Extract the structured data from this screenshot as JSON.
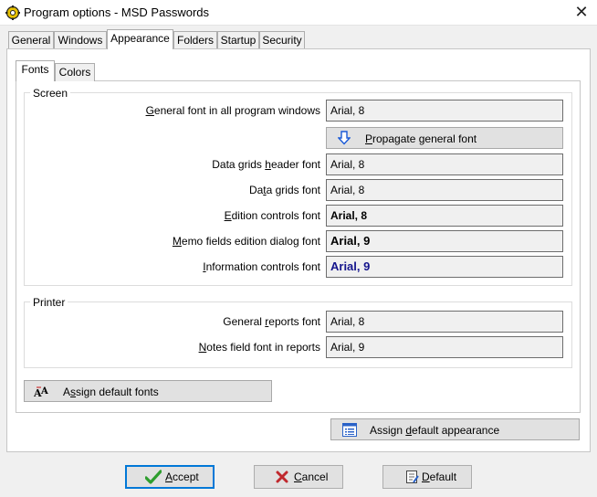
{
  "window": {
    "title": "Program options - MSD Passwords"
  },
  "tabs": [
    {
      "label": "General"
    },
    {
      "label": "Windows"
    },
    {
      "label": "Appearance"
    },
    {
      "label": "Folders"
    },
    {
      "label": "Startup"
    },
    {
      "label": "Security"
    }
  ],
  "subtabs": [
    {
      "label": "Fonts"
    },
    {
      "label": "Colors"
    }
  ],
  "screen": {
    "legend": "Screen",
    "rows": [
      {
        "label_pre": "",
        "label_key": "G",
        "label_post": "eneral font in all program windows",
        "value": "Arial, 8"
      },
      {
        "label_pre": "Data grids ",
        "label_key": "h",
        "label_post": "eader font",
        "value": "Arial, 8"
      },
      {
        "label_pre": "Da",
        "label_key": "t",
        "label_post": "a grids font",
        "value": "Arial, 8"
      },
      {
        "label_pre": "",
        "label_key": "E",
        "label_post": "dition controls font",
        "value": "Arial, 8"
      },
      {
        "label_pre": "",
        "label_key": "M",
        "label_post": "emo fields edition dialog font",
        "value": "Arial, 9"
      },
      {
        "label_pre": "",
        "label_key": "I",
        "label_post": "nformation controls font",
        "value": "Arial, 9"
      }
    ],
    "propagate": {
      "pre": "",
      "key": "P",
      "post": "ropagate general font"
    }
  },
  "printer": {
    "legend": "Printer",
    "rows": [
      {
        "label_pre": "General ",
        "label_key": "r",
        "label_post": "eports font",
        "value": "Arial, 8"
      },
      {
        "label_pre": "",
        "label_key": "N",
        "label_post": "otes field font in reports",
        "value": "Arial, 9"
      }
    ]
  },
  "assign_default_fonts": {
    "pre": "A",
    "key": "s",
    "post": "sign default fonts"
  },
  "assign_default_appearance": {
    "pre": "Assign ",
    "key": "d",
    "post": "efault appearance"
  },
  "footer": {
    "accept": {
      "pre": "",
      "key": "A",
      "post": "ccept"
    },
    "cancel": {
      "pre": "",
      "key": "C",
      "post": "ancel"
    },
    "default": {
      "pre": "",
      "key": "D",
      "post": "efault"
    }
  },
  "colors": {
    "accent": "#0078d7",
    "info_font": "#14148c",
    "check": "#2e9e2e",
    "cancel_x": "#c0282d"
  }
}
